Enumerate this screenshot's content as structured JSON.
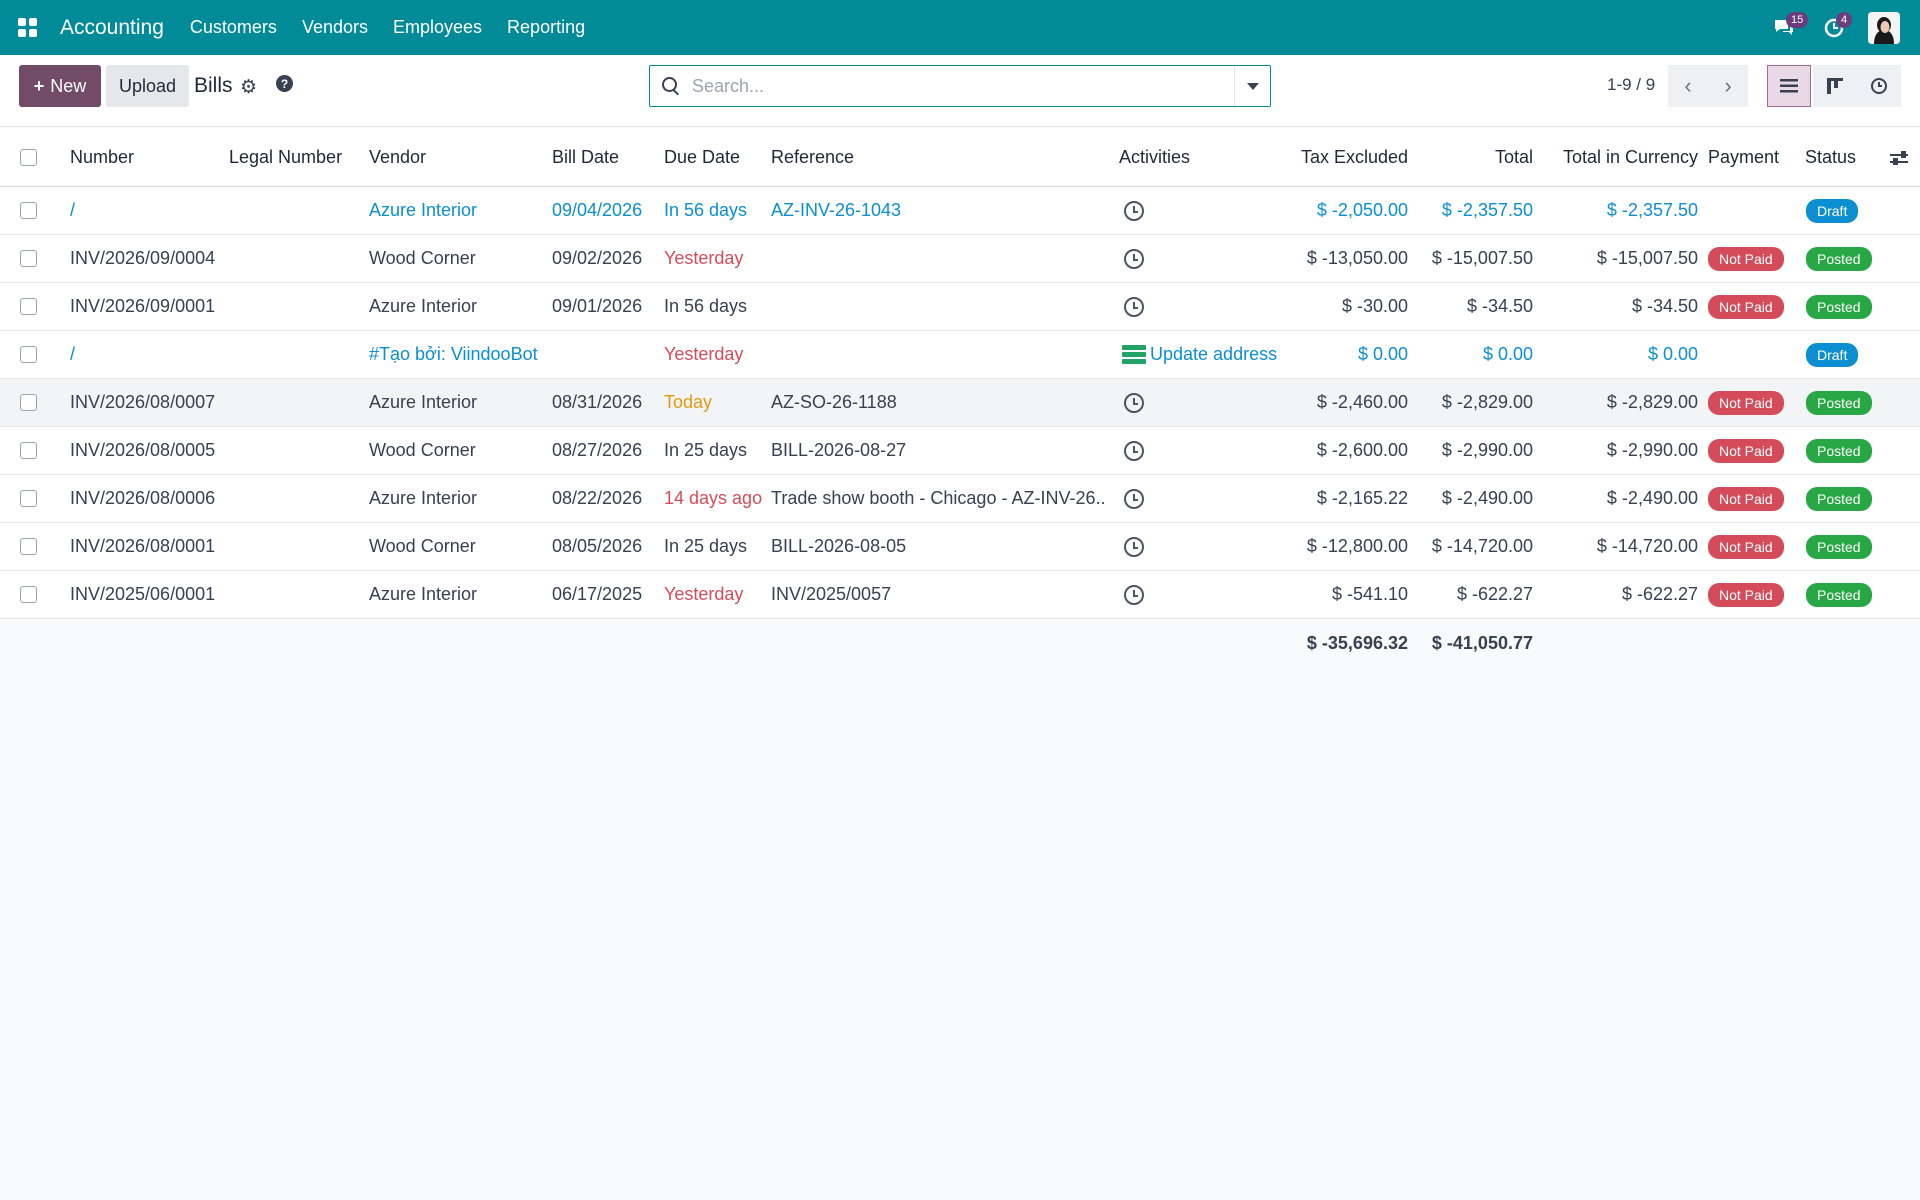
{
  "navbar": {
    "app_name": "Accounting",
    "menu": [
      "Customers",
      "Vendors",
      "Employees",
      "Reporting"
    ],
    "messages_count": "15",
    "activities_count": "4",
    "icons": [
      "apps-icon",
      "chat-icon",
      "clock-icon",
      "avatar"
    ]
  },
  "control": {
    "new_label": "New",
    "upload_label": "Upload",
    "title": "Bills",
    "search_placeholder": "Search...",
    "pager": "1-9 / 9"
  },
  "columns": {
    "number": "Number",
    "legal_number": "Legal Number",
    "vendor": "Vendor",
    "bill_date": "Bill Date",
    "due_date": "Due Date",
    "reference": "Reference",
    "activities": "Activities",
    "tax_excluded": "Tax Excluded",
    "total": "Total",
    "total_currency": "Total in Currency",
    "payment": "Payment",
    "status": "Status"
  },
  "rows": [
    {
      "number": "/",
      "vendor": "Azure Interior",
      "bill_date": "09/04/2026",
      "due_date": "In 56 days",
      "reference": "AZ-INV-26-1043",
      "activity": "",
      "tax_excluded": "$ -2,050.00",
      "total": "$ -2,357.50",
      "total_currency": "$ -2,357.50",
      "payment": "",
      "status": "Draft",
      "style": "draft"
    },
    {
      "number": "INV/2026/09/0004",
      "vendor": "Wood Corner",
      "bill_date": "09/02/2026",
      "due_date": "Yesterday",
      "reference": "",
      "activity": "",
      "tax_excluded": "$ -13,050.00",
      "total": "$ -15,007.50",
      "total_currency": "$ -15,007.50",
      "payment": "Not Paid",
      "status": "Posted",
      "style": "posted"
    },
    {
      "number": "INV/2026/09/0001",
      "vendor": "Azure Interior",
      "bill_date": "09/01/2026",
      "due_date": "In 56 days",
      "reference": "",
      "activity": "",
      "tax_excluded": "$ -30.00",
      "total": "$ -34.50",
      "total_currency": "$ -34.50",
      "payment": "Not Paid",
      "status": "Posted",
      "style": "posted"
    },
    {
      "number": "/",
      "vendor": "#Tạo bởi: ViindooBot",
      "bill_date": "",
      "due_date": "Yesterday",
      "reference": "",
      "activity": "Update address",
      "tax_excluded": "$ 0.00",
      "total": "$ 0.00",
      "total_currency": "$ 0.00",
      "payment": "",
      "status": "Draft",
      "style": "draft"
    },
    {
      "number": "INV/2026/08/0007",
      "vendor": "Azure Interior",
      "bill_date": "08/31/2026",
      "due_date": "Today",
      "reference": "AZ-SO-26-1188",
      "activity": "",
      "tax_excluded": "$ -2,460.00",
      "total": "$ -2,829.00",
      "total_currency": "$ -2,829.00",
      "payment": "Not Paid",
      "status": "Posted",
      "style": "posted"
    },
    {
      "number": "INV/2026/08/0005",
      "vendor": "Wood Corner",
      "bill_date": "08/27/2026",
      "due_date": "In 25 days",
      "reference": "BILL-2026-08-27",
      "activity": "",
      "tax_excluded": "$ -2,600.00",
      "total": "$ -2,990.00",
      "total_currency": "$ -2,990.00",
      "payment": "Not Paid",
      "status": "Posted",
      "style": "posted"
    },
    {
      "number": "INV/2026/08/0006",
      "vendor": "Azure Interior",
      "bill_date": "08/22/2026",
      "due_date": "14 days ago",
      "reference": "Trade show booth - Chicago - AZ-INV-26...",
      "activity": "",
      "tax_excluded": "$ -2,165.22",
      "total": "$ -2,490.00",
      "total_currency": "$ -2,490.00",
      "payment": "Not Paid",
      "status": "Posted",
      "style": "posted"
    },
    {
      "number": "INV/2026/08/0001",
      "vendor": "Wood Corner",
      "bill_date": "08/05/2026",
      "due_date": "In 25 days",
      "reference": "BILL-2026-08-05",
      "activity": "",
      "tax_excluded": "$ -12,800.00",
      "total": "$ -14,720.00",
      "total_currency": "$ -14,720.00",
      "payment": "Not Paid",
      "status": "Posted",
      "style": "posted"
    },
    {
      "number": "INV/2025/06/0001",
      "vendor": "Azure Interior",
      "bill_date": "06/17/2025",
      "due_date": "Yesterday",
      "reference": "INV/2025/0057",
      "activity": "",
      "tax_excluded": "$ -541.10",
      "total": "$ -622.27",
      "total_currency": "$ -622.27",
      "payment": "Not Paid",
      "status": "Posted",
      "style": "posted"
    }
  ],
  "totals": {
    "tax_excluded": "$ -35,696.32",
    "total": "$ -41,050.77"
  },
  "colors": {
    "navbar": "#018a98",
    "primary": "#714b67",
    "link": "#0b8fd0",
    "danger": "#d44c59",
    "success": "#28a745",
    "warning": "#e09c10"
  }
}
